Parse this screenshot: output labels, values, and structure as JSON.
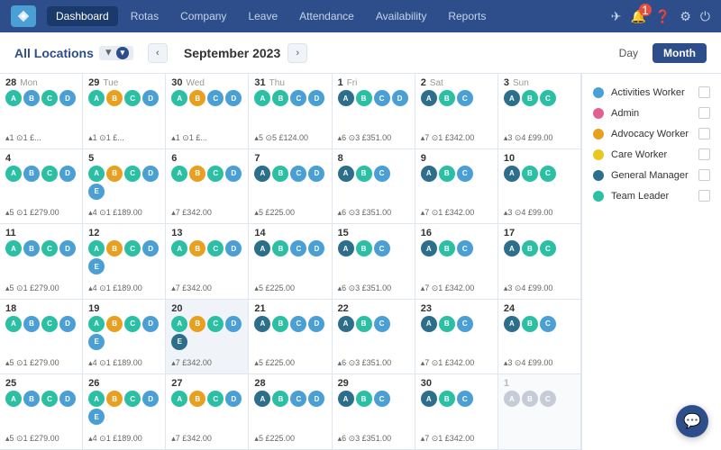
{
  "nav": {
    "items": [
      "Dashboard",
      "Rotas",
      "Company",
      "Leave",
      "Attendance",
      "Availability",
      "Reports"
    ],
    "active": "Dashboard"
  },
  "header": {
    "location": "All Locations",
    "period": "September 2023",
    "view_day": "Day",
    "view_month": "Month"
  },
  "legend": {
    "items": [
      {
        "label": "Activities Worker",
        "color": "#4a9fd4"
      },
      {
        "label": "Admin",
        "color": "#e06090"
      },
      {
        "label": "Advocacy Worker",
        "color": "#e8a020"
      },
      {
        "label": "Care Worker",
        "color": "#e8c820"
      },
      {
        "label": "General Manager",
        "color": "#2d6e8a"
      },
      {
        "label": "Team Leader",
        "color": "#2bbfa4"
      }
    ]
  },
  "calendar": {
    "weeks": [
      {
        "days": [
          {
            "num": "28",
            "name": "Mon",
            "avatars": [
              {
                "t": "teal"
              },
              {
                "t": "blue"
              },
              {
                "t": "teal"
              },
              {
                "t": "blue"
              }
            ],
            "stats": "▴1 ⊙1 £..."
          },
          {
            "num": "29",
            "name": "Tue",
            "avatars": [
              {
                "t": "teal"
              },
              {
                "t": "orange"
              },
              {
                "t": "teal"
              },
              {
                "t": "blue"
              }
            ],
            "stats": "▴1 ⊙1 £..."
          },
          {
            "num": "30",
            "name": "Wed",
            "avatars": [
              {
                "t": "teal"
              },
              {
                "t": "orange"
              },
              {
                "t": "blue"
              },
              {
                "t": "blue"
              }
            ],
            "stats": "▴1 ⊙1 £..."
          },
          {
            "num": "31",
            "name": "Thu",
            "avatars": [
              {
                "t": "teal"
              },
              {
                "t": "teal"
              },
              {
                "t": "blue"
              },
              {
                "t": "blue"
              }
            ],
            "stats": "▴5 ⊙5 £124.00"
          },
          {
            "num": "1",
            "name": "Fri",
            "avatars": [
              {
                "t": "dark-teal"
              },
              {
                "t": "teal"
              },
              {
                "t": "blue"
              },
              {
                "t": "blue"
              }
            ],
            "stats": "▴6 ⊙3 £351.00",
            "new": true
          },
          {
            "num": "2",
            "name": "Sat",
            "avatars": [
              {
                "t": "dark-teal"
              },
              {
                "t": "teal"
              },
              {
                "t": "blue"
              }
            ],
            "stats": "▴7 ⊙1 £342.00",
            "new": true
          },
          {
            "num": "3",
            "name": "Sun",
            "avatars": [
              {
                "t": "dark-teal"
              },
              {
                "t": "teal"
              },
              {
                "t": "teal"
              }
            ],
            "stats": "▴3 ⊙4 £99.00",
            "new": true
          }
        ]
      },
      {
        "days": [
          {
            "num": "4",
            "name": "",
            "avatars": [
              {
                "t": "teal"
              },
              {
                "t": "blue"
              },
              {
                "t": "teal"
              },
              {
                "t": "blue"
              }
            ],
            "stats": "▴5 ⊙1 £279.00"
          },
          {
            "num": "5",
            "name": "",
            "avatars": [
              {
                "t": "teal"
              },
              {
                "t": "orange"
              },
              {
                "t": "teal"
              },
              {
                "t": "blue"
              },
              {
                "t": "blue"
              }
            ],
            "stats": "▴4 ⊙1 £189.00"
          },
          {
            "num": "6",
            "name": "",
            "avatars": [
              {
                "t": "teal"
              },
              {
                "t": "orange"
              },
              {
                "t": "teal"
              },
              {
                "t": "blue"
              }
            ],
            "stats": "▴7 £342.00"
          },
          {
            "num": "7",
            "name": "",
            "avatars": [
              {
                "t": "dark-teal"
              },
              {
                "t": "teal"
              },
              {
                "t": "blue"
              },
              {
                "t": "blue"
              }
            ],
            "stats": "▴5 £225.00"
          },
          {
            "num": "8",
            "name": "",
            "avatars": [
              {
                "t": "dark-teal"
              },
              {
                "t": "teal"
              },
              {
                "t": "blue"
              }
            ],
            "stats": "▴6 ⊙3 £351.00"
          },
          {
            "num": "9",
            "name": "",
            "avatars": [
              {
                "t": "dark-teal"
              },
              {
                "t": "teal"
              },
              {
                "t": "blue"
              }
            ],
            "stats": "▴7 ⊙1 £342.00"
          },
          {
            "num": "10",
            "name": "",
            "avatars": [
              {
                "t": "dark-teal"
              },
              {
                "t": "teal"
              },
              {
                "t": "teal"
              }
            ],
            "stats": "▴3 ⊙4 £99.00"
          }
        ]
      },
      {
        "days": [
          {
            "num": "11",
            "name": "",
            "avatars": [
              {
                "t": "teal"
              },
              {
                "t": "blue"
              },
              {
                "t": "teal"
              },
              {
                "t": "blue"
              }
            ],
            "stats": "▴5 ⊙1 £279.00"
          },
          {
            "num": "12",
            "name": "",
            "avatars": [
              {
                "t": "teal"
              },
              {
                "t": "orange"
              },
              {
                "t": "teal"
              },
              {
                "t": "blue"
              },
              {
                "t": "blue"
              }
            ],
            "stats": "▴4 ⊙1 £189.00"
          },
          {
            "num": "13",
            "name": "",
            "avatars": [
              {
                "t": "teal"
              },
              {
                "t": "orange"
              },
              {
                "t": "teal"
              },
              {
                "t": "blue"
              }
            ],
            "stats": "▴7 £342.00"
          },
          {
            "num": "14",
            "name": "",
            "avatars": [
              {
                "t": "dark-teal"
              },
              {
                "t": "teal"
              },
              {
                "t": "blue"
              },
              {
                "t": "blue"
              }
            ],
            "stats": "▴5 £225.00"
          },
          {
            "num": "15",
            "name": "",
            "avatars": [
              {
                "t": "dark-teal"
              },
              {
                "t": "teal"
              },
              {
                "t": "blue"
              }
            ],
            "stats": "▴6 ⊙3 £351.00"
          },
          {
            "num": "16",
            "name": "",
            "avatars": [
              {
                "t": "dark-teal"
              },
              {
                "t": "teal"
              },
              {
                "t": "blue"
              }
            ],
            "stats": "▴7 ⊙1 £342.00"
          },
          {
            "num": "17",
            "name": "",
            "avatars": [
              {
                "t": "dark-teal"
              },
              {
                "t": "teal"
              },
              {
                "t": "teal"
              }
            ],
            "stats": "▴3 ⊙4 £99.00"
          }
        ]
      },
      {
        "days": [
          {
            "num": "18",
            "name": "",
            "avatars": [
              {
                "t": "teal"
              },
              {
                "t": "blue"
              },
              {
                "t": "teal"
              },
              {
                "t": "blue"
              }
            ],
            "stats": "▴5 ⊙1 £279.00"
          },
          {
            "num": "19",
            "name": "",
            "avatars": [
              {
                "t": "teal"
              },
              {
                "t": "orange"
              },
              {
                "t": "teal"
              },
              {
                "t": "blue"
              },
              {
                "t": "blue"
              }
            ],
            "stats": "▴4 ⊙1 £189.00"
          },
          {
            "num": "20",
            "name": "",
            "avatars": [
              {
                "t": "teal"
              },
              {
                "t": "orange"
              },
              {
                "t": "teal"
              },
              {
                "t": "blue"
              },
              {
                "t": "dark-teal"
              }
            ],
            "stats": "▴7 £342.00",
            "highlighted": true
          },
          {
            "num": "21",
            "name": "",
            "avatars": [
              {
                "t": "dark-teal"
              },
              {
                "t": "teal"
              },
              {
                "t": "blue"
              },
              {
                "t": "blue"
              }
            ],
            "stats": "▴5 £225.00"
          },
          {
            "num": "22",
            "name": "",
            "avatars": [
              {
                "t": "dark-teal"
              },
              {
                "t": "teal"
              },
              {
                "t": "blue"
              }
            ],
            "stats": "▴6 ⊙3 £351.00"
          },
          {
            "num": "23",
            "name": "",
            "avatars": [
              {
                "t": "dark-teal"
              },
              {
                "t": "teal"
              },
              {
                "t": "blue"
              }
            ],
            "stats": "▴7 ⊙1 £342.00"
          },
          {
            "num": "24",
            "name": "",
            "avatars": [
              {
                "t": "dark-teal"
              },
              {
                "t": "teal"
              },
              {
                "t": "blue"
              }
            ],
            "stats": "▴3 ⊙4 £99.00"
          }
        ]
      },
      {
        "days": [
          {
            "num": "25",
            "name": "",
            "avatars": [
              {
                "t": "teal"
              },
              {
                "t": "blue"
              },
              {
                "t": "teal"
              },
              {
                "t": "blue"
              }
            ],
            "stats": "▴5 ⊙1 £279.00"
          },
          {
            "num": "26",
            "name": "",
            "avatars": [
              {
                "t": "teal"
              },
              {
                "t": "orange"
              },
              {
                "t": "teal"
              },
              {
                "t": "blue"
              },
              {
                "t": "blue"
              }
            ],
            "stats": "▴4 ⊙1 £189.00"
          },
          {
            "num": "27",
            "name": "",
            "avatars": [
              {
                "t": "teal"
              },
              {
                "t": "orange"
              },
              {
                "t": "teal"
              },
              {
                "t": "blue"
              }
            ],
            "stats": "▴7 £342.00"
          },
          {
            "num": "28",
            "name": "",
            "avatars": [
              {
                "t": "dark-teal"
              },
              {
                "t": "teal"
              },
              {
                "t": "blue"
              },
              {
                "t": "blue"
              }
            ],
            "stats": "▴5 £225.00"
          },
          {
            "num": "29",
            "name": "",
            "avatars": [
              {
                "t": "dark-teal"
              },
              {
                "t": "teal"
              },
              {
                "t": "blue"
              }
            ],
            "stats": "▴6 ⊙3 £351.00"
          },
          {
            "num": "30",
            "name": "",
            "avatars": [
              {
                "t": "dark-teal"
              },
              {
                "t": "teal"
              },
              {
                "t": "blue"
              }
            ],
            "stats": "▴7 ⊙1 £342.00"
          },
          {
            "num": "1",
            "name": "",
            "avatars": [
              {
                "t": "light-gray"
              },
              {
                "t": "light-gray"
              },
              {
                "t": "light-gray"
              }
            ],
            "stats": "",
            "other": true
          }
        ]
      }
    ]
  }
}
